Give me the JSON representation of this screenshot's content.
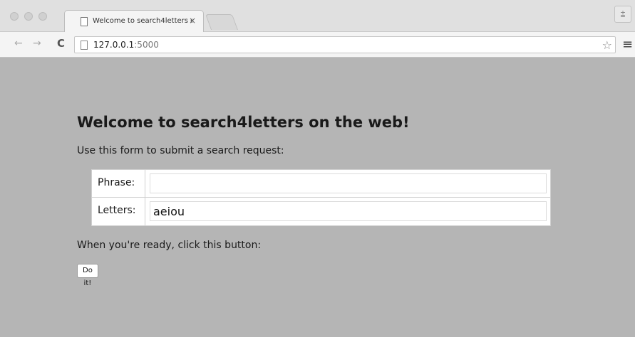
{
  "browser": {
    "tab_title": "Welcome to search4letters on the web!",
    "tab_close": "×",
    "profile_glyph": "⩲",
    "nav_back": "←",
    "nav_forward": "→",
    "reload": "C",
    "url_host": "127.0.0.1",
    "url_port": ":5000",
    "bookmark_star": "☆",
    "menu_glyph": "≡"
  },
  "page": {
    "title": "Welcome to search4letters on the web!",
    "intro": "Use this form to submit a search request:",
    "form": {
      "phrase_label": "Phrase:",
      "phrase_value": "",
      "letters_label": "Letters:",
      "letters_value": "aeiou"
    },
    "ready_text": "When you're ready, click this button:",
    "submit_label": "Do it!"
  },
  "colors": {
    "page_background": "#b5b5b5",
    "chrome_background": "#e0e0e0"
  }
}
